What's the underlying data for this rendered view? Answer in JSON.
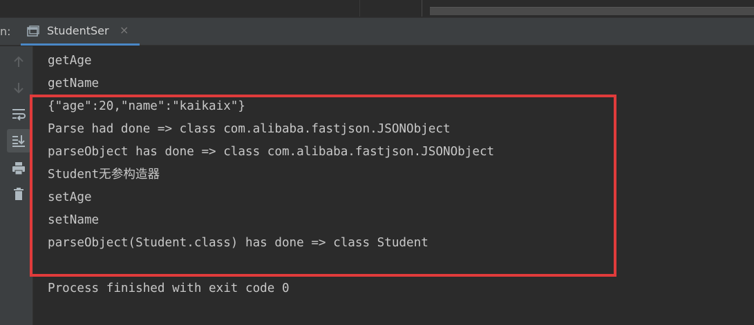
{
  "window": {
    "run_label": "n:",
    "tab": {
      "label": "StudentSer",
      "close": "×"
    }
  },
  "toolbar": [
    {
      "name": "up-arrow-icon"
    },
    {
      "name": "down-arrow-icon"
    },
    {
      "name": "soft-wrap-icon"
    },
    {
      "name": "scroll-to-end-icon",
      "active": true
    },
    {
      "name": "print-icon"
    },
    {
      "name": "trash-icon"
    }
  ],
  "console": {
    "lines": [
      "getAge",
      "getName",
      "{\"age\":20,\"name\":\"kaikaix\"}",
      "Parse had done => class com.alibaba.fastjson.JSONObject",
      "parseObject has done => class com.alibaba.fastjson.JSONObject",
      "Student无参构造器",
      "setAge",
      "setName",
      "parseObject(Student.class) has done => class Student",
      "",
      "Process finished with exit code 0"
    ]
  },
  "colors": {
    "background": "#2b2b2b",
    "panel": "#3c3f41",
    "text": "#c8c8c8",
    "highlight": "#e03b3b",
    "tab_accent": "#4a88c7"
  }
}
